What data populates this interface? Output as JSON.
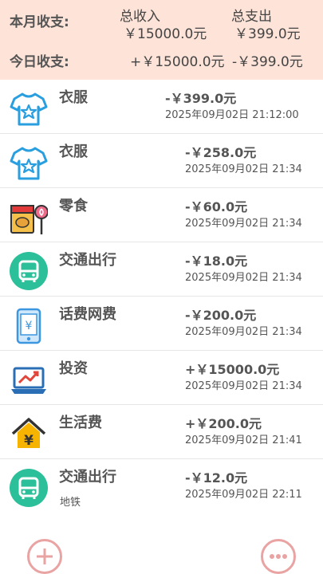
{
  "summary": {
    "month_label": "本月收支:",
    "total_income_label": "总收入",
    "total_expense_label": "总支出",
    "month_income": "￥15000.0元",
    "month_expense": "￥399.0元",
    "today_label": "今日收支:",
    "today_income": "+￥15000.0元",
    "today_expense": "-￥399.0元"
  },
  "records": [
    {
      "category": "衣服",
      "note": "",
      "amount": "-￥399.0元",
      "time": "2025年09月02日  21:12:00",
      "icon": "tshirt-icon"
    },
    {
      "category": "衣服",
      "note": "",
      "amount": "-￥258.0元",
      "time": "2025年09月02日 21:34",
      "icon": "tshirt-icon"
    },
    {
      "category": "零食",
      "note": "",
      "amount": "-￥60.0元",
      "time": "2025年09月02日 21:34",
      "icon": "snack-icon"
    },
    {
      "category": "交通出行",
      "note": "",
      "amount": "-￥18.0元",
      "time": "2025年09月02日 21:34",
      "icon": "bus-icon"
    },
    {
      "category": "话费网费",
      "note": "",
      "amount": "-￥200.0元",
      "time": "2025年09月02日 21:34",
      "icon": "phone-bill-icon"
    },
    {
      "category": "投资",
      "note": "",
      "amount": "+￥15000.0元",
      "time": "2025年09月02日 21:34",
      "icon": "investment-icon"
    },
    {
      "category": "生活费",
      "note": "",
      "amount": "+￥200.0元",
      "time": "2025年09月02日 21:41",
      "icon": "living-expense-icon"
    },
    {
      "category": "交通出行",
      "note": "地铁",
      "amount": "-￥12.0元",
      "time": "2025年09月02日 22:11",
      "icon": "bus-icon"
    }
  ],
  "colors": {
    "header_bg": "#fde3d8",
    "accent_teal": "#2bbf9a",
    "accent_blue": "#2a9fe0",
    "fab_border": "#e9a3a3"
  }
}
